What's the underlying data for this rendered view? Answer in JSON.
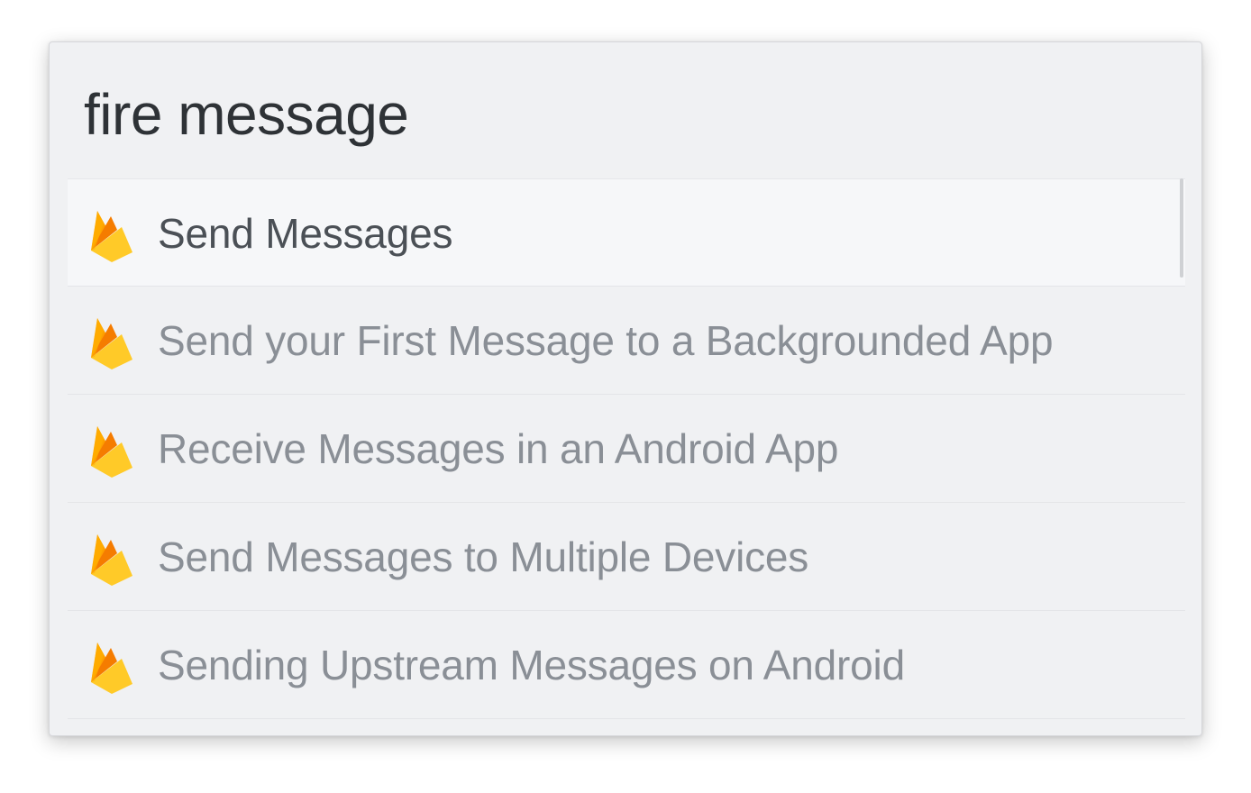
{
  "search": {
    "query": "fire message"
  },
  "results": [
    {
      "label": "Send Messages",
      "icon": "firebase-icon",
      "selected": true
    },
    {
      "label": "Send your First Message to a Backgrounded App",
      "icon": "firebase-icon",
      "selected": false
    },
    {
      "label": "Receive Messages in an Android App",
      "icon": "firebase-icon",
      "selected": false
    },
    {
      "label": "Send Messages to Multiple Devices",
      "icon": "firebase-icon",
      "selected": false
    },
    {
      "label": "Sending Upstream Messages on Android",
      "icon": "firebase-icon",
      "selected": false
    }
  ],
  "colors": {
    "background": "#f0f1f3",
    "selected_row": "#f6f7f9",
    "query_text": "#2e3236",
    "result_text": "#8a8f96",
    "selected_text": "#4b5056",
    "firebase_yellow": "#ffca28",
    "firebase_orange": "#ffa000",
    "firebase_dark_orange": "#f57c00"
  }
}
